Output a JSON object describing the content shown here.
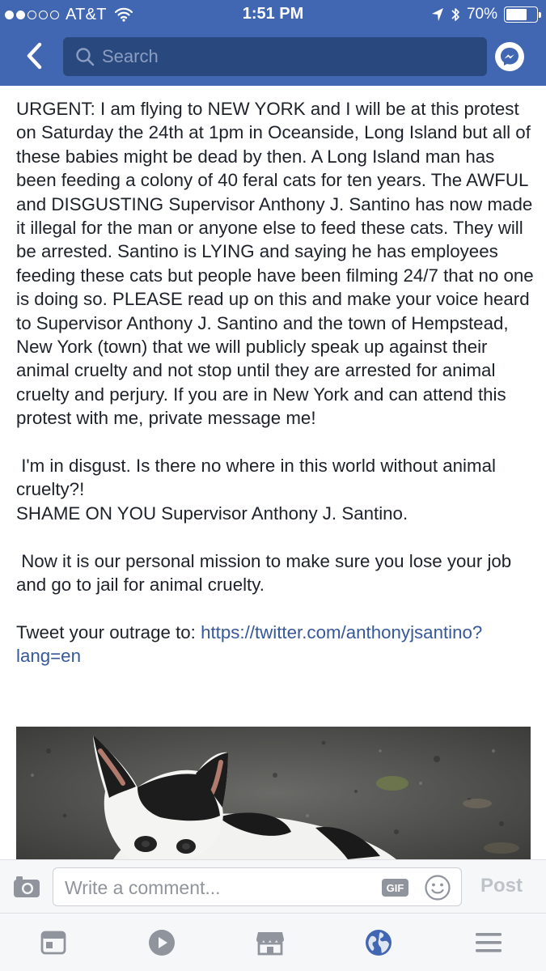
{
  "status_bar": {
    "carrier": "AT&T",
    "time": "1:51 PM",
    "battery_percent": "70%",
    "battery_level": 0.7,
    "signal_bars_filled": 2,
    "signal_bars_total": 5
  },
  "nav": {
    "search_placeholder": "Search"
  },
  "post": {
    "paragraph_1": "URGENT: I am flying to NEW YORK and I will be at this protest on Saturday the 24th at 1pm in Oceanside, Long Island but all of these babies might be dead by then. A Long Island man has been feeding a colony of 40 feral cats for ten years. The AWFUL and DISGUSTING Supervisor Anthony J. Santino has now made it illegal for the man or anyone else to feed these cats. They will be arrested. Santino is LYING and saying he has employees feeding these cats but people have been filming 24/7 that no one is doing so. PLEASE read up on this and make your voice heard to Supervisor Anthony J. Santino and the town of Hempstead, New York (town) that we will publicly speak up against their animal cruelty and not stop until they are arrested for animal cruelty and perjury. If you are in New York and can attend this protest with me, private message me!",
    "paragraph_2": " I'm in disgust. Is there no where in this world without animal cruelty?!",
    "paragraph_3": "SHAME ON YOU Supervisor Anthony J. Santino.",
    "paragraph_4": " Now it is our personal mission to make sure you lose your job and go to jail for animal cruelty.",
    "tweet_prefix": "Tweet your outrage to: ",
    "tweet_link": "https://twitter.com/anthonyjsantino?lang=en"
  },
  "comment_bar": {
    "placeholder": "Write a comment...",
    "gif_label": "GIF",
    "post_label": "Post"
  },
  "tabs": [
    {
      "name": "news-feed",
      "icon": "news-feed-icon"
    },
    {
      "name": "video",
      "icon": "play-icon"
    },
    {
      "name": "marketplace",
      "icon": "marketplace-icon"
    },
    {
      "name": "notifications",
      "icon": "globe-icon"
    },
    {
      "name": "menu",
      "icon": "menu-icon"
    }
  ],
  "colors": {
    "brand": "#4267b2",
    "search_bg": "#29487d",
    "link": "#365899",
    "active_tab": "#4267b2",
    "inactive_tab": "#90949c"
  }
}
